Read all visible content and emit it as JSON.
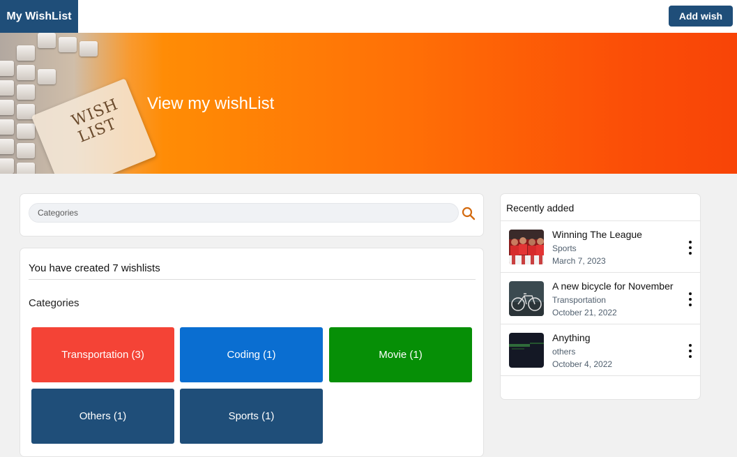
{
  "header": {
    "brand": "My WishList",
    "add_button": "Add wish"
  },
  "hero": {
    "title": "View my wishList",
    "art_text": "WISH LIST"
  },
  "search": {
    "placeholder": "Categories",
    "icon": "search-icon"
  },
  "summary": {
    "count_text": "You have created 7 wishlists",
    "categories_heading": "Categories"
  },
  "categories": [
    {
      "label": "Transportation (3)",
      "color": "#f44336"
    },
    {
      "label": "Coding (1)",
      "color": "#0a6ed1"
    },
    {
      "label": "Movie (1)",
      "color": "#068f06"
    },
    {
      "label": "Others (1)",
      "color": "#1f4e79"
    },
    {
      "label": "Sports (1)",
      "color": "#1f4e79"
    }
  ],
  "recent": {
    "title": "Recently added",
    "items": [
      {
        "title": "Winning The League",
        "category": "Sports",
        "date": "March 7, 2023"
      },
      {
        "title": "A new bicycle for November",
        "category": "Transportation",
        "date": "October 21, 2022"
      },
      {
        "title": "Anything",
        "category": "others",
        "date": "October 4, 2022"
      }
    ]
  },
  "colors": {
    "brand": "#1f4e79",
    "accent_orange": "#ff7a06"
  }
}
